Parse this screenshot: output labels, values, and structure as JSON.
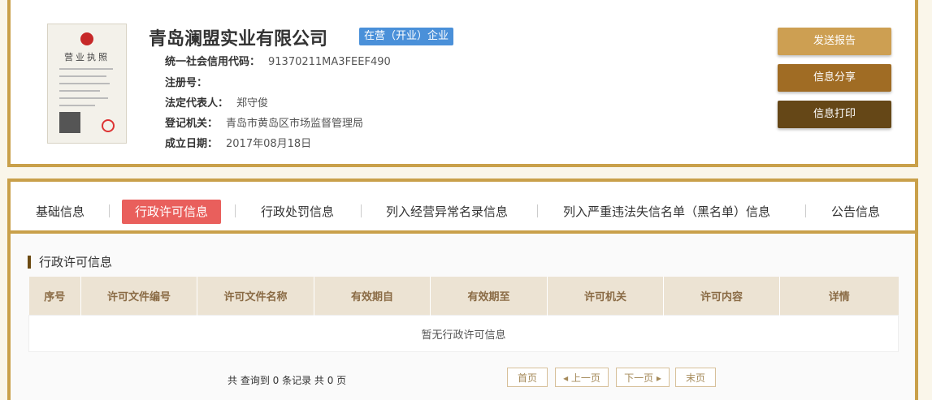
{
  "company": {
    "name": "青岛澜盟实业有限公司",
    "status": "在营（开业）企业",
    "license_image": {
      "title": "营业执照"
    },
    "fields": [
      {
        "key": "统一社会信用代码：",
        "value": "91370211MA3FEEF490"
      },
      {
        "key": "注册号：",
        "value": ""
      },
      {
        "key": "法定代表人：",
        "value": "郑守俊"
      },
      {
        "key": "登记机关：",
        "value": "青岛市黄岛区市场监督管理局"
      },
      {
        "key": "成立日期：",
        "value": "2017年08月18日"
      }
    ]
  },
  "actions": {
    "send_report": "发送报告",
    "share": "信息分享",
    "print": "信息打印"
  },
  "tabs": [
    {
      "label": "基础信息"
    },
    {
      "label": "行政许可信息"
    },
    {
      "label": "行政处罚信息"
    },
    {
      "label": "列入经营异常名录信息"
    },
    {
      "label": "列入严重违法失信名单（黑名单）信息"
    },
    {
      "label": "公告信息"
    }
  ],
  "section": {
    "title": "行政许可信息",
    "columns": [
      "序号",
      "许可文件编号",
      "许可文件名称",
      "有效期自",
      "有效期至",
      "许可机关",
      "许可内容",
      "详情"
    ],
    "empty_text": "暂无行政许可信息"
  },
  "pagination": {
    "summary": "共 查询到 0 条记录 共 0 页",
    "first": "首页",
    "prev": "◂ 上一页",
    "next": "下一页 ▸",
    "last": "末页"
  },
  "colors": {
    "frame": "#c9a04a",
    "active_tab": "#e95f5c",
    "status_badge": "#4a90d9",
    "btn_send": "#cd9f52",
    "btn_share": "#a06c24",
    "btn_print": "#654717"
  }
}
